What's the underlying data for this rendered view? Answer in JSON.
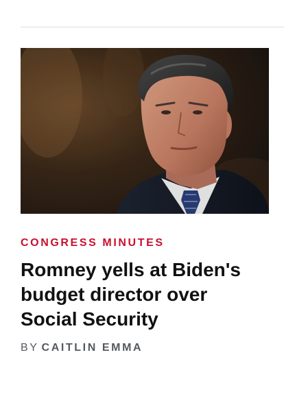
{
  "article": {
    "category": "CONGRESS MINUTES",
    "headline": "Romney yells at Biden's budget director over Social Security",
    "byline_prefix": "BY",
    "author": "CAITLIN EMMA",
    "image_alt": "Photo of Mitt Romney"
  },
  "colors": {
    "category": "#c8102e",
    "headline": "#111111",
    "byline": "#555a60",
    "rule": "#dcdcdc"
  }
}
